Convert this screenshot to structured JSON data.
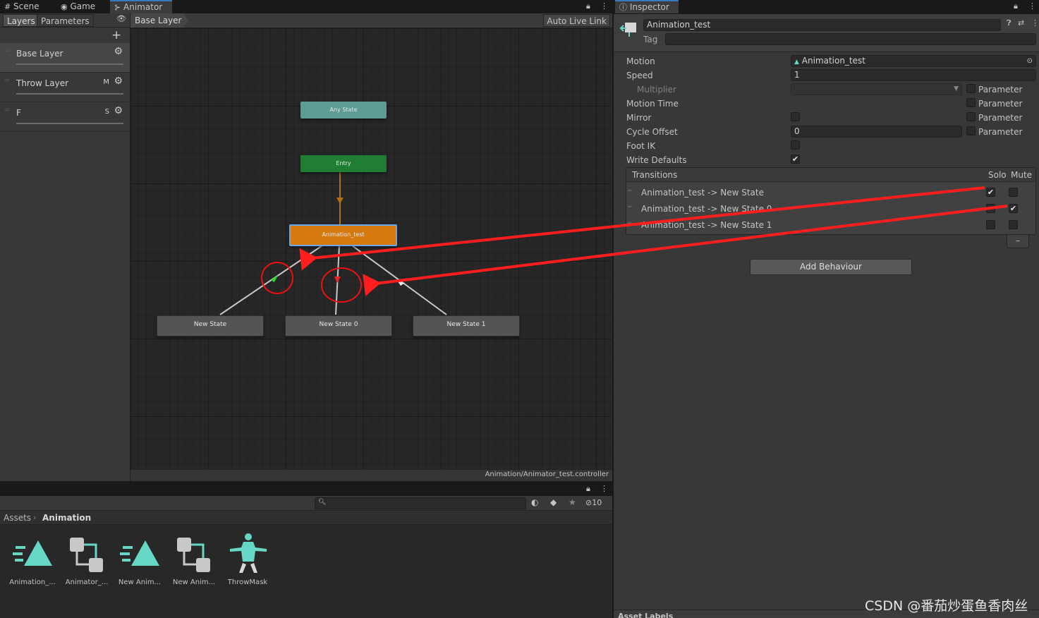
{
  "top_tabs": {
    "scene": "Scene",
    "game": "Game",
    "animator": "Animator"
  },
  "animator": {
    "tabs": {
      "layers": "Layers",
      "parameters": "Parameters"
    },
    "add_symbol": "+",
    "breadcrumb": "Base Layer",
    "auto_live_link": "Auto Live Link",
    "layers": [
      {
        "name": "Base Layer",
        "flag": ""
      },
      {
        "name": "Throw Layer",
        "flag": "M"
      },
      {
        "name": "F",
        "flag": "S"
      }
    ],
    "nodes": {
      "any_state": "Any State",
      "entry": "Entry",
      "current": "Animation_test",
      "state_a": "New State",
      "state_b": "New State 0",
      "state_c": "New State 1"
    },
    "footer_path": "Animation/Animator_test.controller"
  },
  "project": {
    "breadcrumb": {
      "root": "Assets",
      "current": "Animation"
    },
    "hidden_count": "10",
    "assets": [
      {
        "label": "Animation_...",
        "icon": "animation-clip-icon"
      },
      {
        "label": "Animator_...",
        "icon": "animator-controller-icon"
      },
      {
        "label": "New Anim...",
        "icon": "animation-clip-icon"
      },
      {
        "label": "New Anim...",
        "icon": "animator-controller-icon"
      },
      {
        "label": "ThrowMask",
        "icon": "avatar-mask-icon"
      }
    ]
  },
  "inspector": {
    "tab": "Inspector",
    "object_name": "Animation_test",
    "tag_label": "Tag",
    "motion_label": "Motion",
    "motion_value": "Animation_test",
    "speed_label": "Speed",
    "speed_value": "1",
    "multiplier_label": "Multiplier",
    "motion_time_label": "Motion Time",
    "mirror_label": "Mirror",
    "cycle_offset_label": "Cycle Offset",
    "cycle_offset_value": "0",
    "foot_ik_label": "Foot IK",
    "write_defaults_label": "Write Defaults",
    "parameter_label": "Parameter",
    "transitions_header": "Transitions",
    "solo_header": "Solo",
    "mute_header": "Mute",
    "transitions": [
      {
        "name": "Animation_test -> New State",
        "solo": "✔",
        "mute": ""
      },
      {
        "name": "Animation_test -> New State 0",
        "solo": "",
        "mute": "✔"
      },
      {
        "name": "Animation_test -> New State 1",
        "solo": "",
        "mute": ""
      }
    ],
    "remove_symbol": "–",
    "add_behaviour": "Add Behaviour",
    "asset_labels": "Asset Labels"
  },
  "watermark": "CSDN @番茄炒蛋鱼香肉丝",
  "colors": {
    "any_state": "#5c9c94",
    "entry": "#1f7d34",
    "current_state": "#d6790f",
    "annotation": "#ff1e1e"
  }
}
